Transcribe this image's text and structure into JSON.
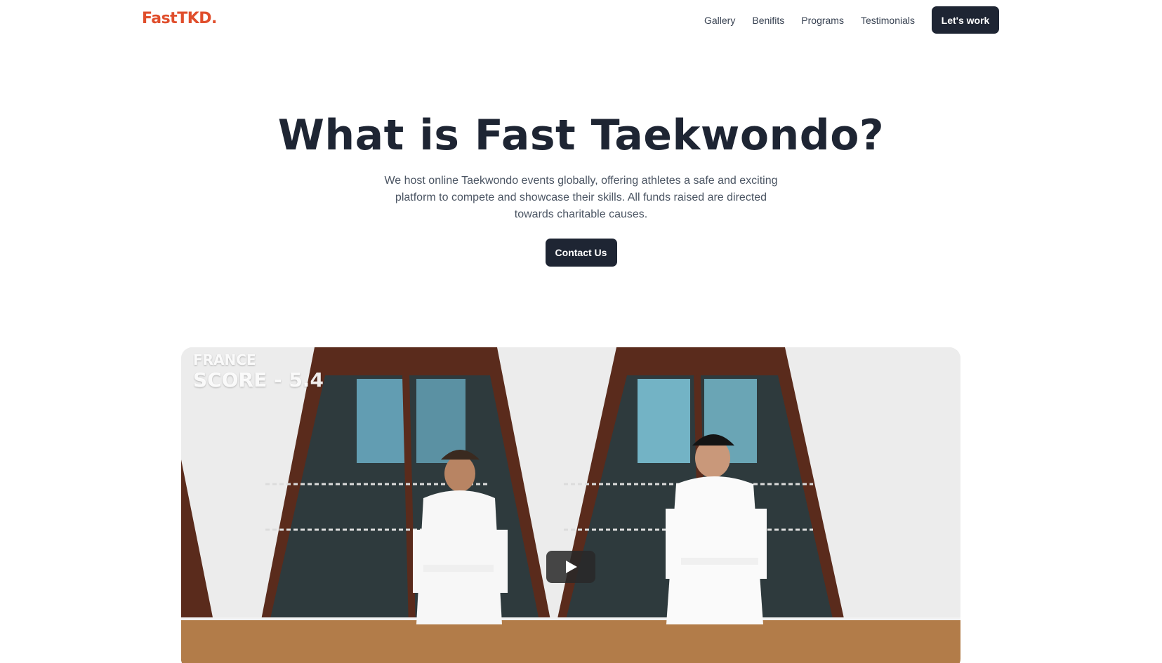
{
  "nav": {
    "logo": "FastTKD.",
    "links": [
      "Gallery",
      "Benifits",
      "Programs",
      "Testimonials"
    ],
    "cta": "Let's work"
  },
  "hero": {
    "title": "What is Fast Taekwondo?",
    "description": "We host online Taekwondo events globally, offering athletes a safe and exciting platform to compete and showcase their skills. All funds raised are directed towards charitable causes.",
    "button": "Contact Us"
  },
  "video": {
    "overlay_country": "FRANCE",
    "overlay_score": "SCORE - 5.4",
    "play_icon": "play-icon"
  },
  "colors": {
    "brand": "#e04e2c",
    "dark": "#1e2533",
    "text_muted": "#4b5563"
  }
}
